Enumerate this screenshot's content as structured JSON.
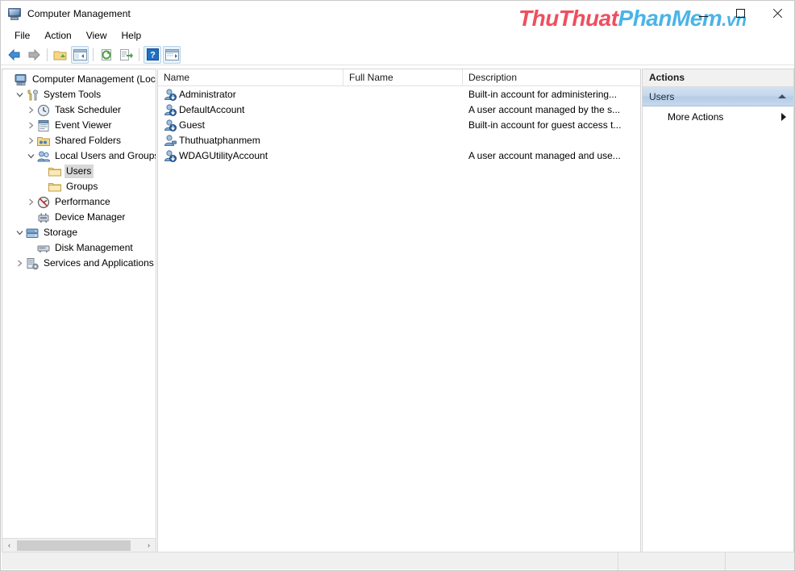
{
  "window": {
    "title": "Computer Management",
    "icon": "computer-icon",
    "controls": {
      "minimize": "–",
      "maximize": "□",
      "close": "✕"
    }
  },
  "watermark": {
    "part1": "ThuThuat",
    "part2": "PhanMem",
    "part3": ".vn"
  },
  "menubar": {
    "items": [
      {
        "label": "File"
      },
      {
        "label": "Action"
      },
      {
        "label": "View"
      },
      {
        "label": "Help"
      }
    ]
  },
  "toolbar": {
    "buttons": [
      {
        "name": "back-icon"
      },
      {
        "name": "forward-icon"
      },
      {
        "name": "separator"
      },
      {
        "name": "up-folder-icon"
      },
      {
        "name": "show-hide-console-tree-icon"
      },
      {
        "name": "separator"
      },
      {
        "name": "refresh-icon"
      },
      {
        "name": "export-list-icon"
      },
      {
        "name": "separator"
      },
      {
        "name": "help-icon"
      },
      {
        "name": "show-action-pane-icon"
      }
    ]
  },
  "tree": {
    "nodes": [
      {
        "label": "Computer Management (Local",
        "icon": "computer-icon",
        "indent": 0,
        "twist": "",
        "selected": false
      },
      {
        "label": "System Tools",
        "icon": "tools-icon",
        "indent": 1,
        "twist": "expanded",
        "selected": false
      },
      {
        "label": "Task Scheduler",
        "icon": "clock-icon",
        "indent": 2,
        "twist": "collapsed",
        "selected": false
      },
      {
        "label": "Event Viewer",
        "icon": "event-viewer-icon",
        "indent": 2,
        "twist": "collapsed",
        "selected": false
      },
      {
        "label": "Shared Folders",
        "icon": "shared-folder-icon",
        "indent": 2,
        "twist": "collapsed",
        "selected": false
      },
      {
        "label": "Local Users and Groups",
        "icon": "users-groups-icon",
        "indent": 2,
        "twist": "expanded",
        "selected": false
      },
      {
        "label": "Users",
        "icon": "folder-icon",
        "indent": 3,
        "twist": "",
        "selected": true
      },
      {
        "label": "Groups",
        "icon": "folder-icon",
        "indent": 3,
        "twist": "",
        "selected": false
      },
      {
        "label": "Performance",
        "icon": "performance-icon",
        "indent": 2,
        "twist": "collapsed",
        "selected": false
      },
      {
        "label": "Device Manager",
        "icon": "device-manager-icon",
        "indent": 2,
        "twist": "",
        "selected": false
      },
      {
        "label": "Storage",
        "icon": "storage-icon",
        "indent": 1,
        "twist": "expanded",
        "selected": false
      },
      {
        "label": "Disk Management",
        "icon": "disk-icon",
        "indent": 2,
        "twist": "",
        "selected": false
      },
      {
        "label": "Services and Applications",
        "icon": "services-icon",
        "indent": 1,
        "twist": "collapsed",
        "selected": false
      }
    ],
    "scrollbar": {
      "left_arrow": "‹",
      "right_arrow": "›"
    }
  },
  "list": {
    "columns": [
      {
        "label": "Name"
      },
      {
        "label": "Full Name"
      },
      {
        "label": "Description"
      }
    ],
    "rows": [
      {
        "name": "Administrator",
        "full_name": "",
        "description": "Built-in account for administering...",
        "icon": "user-disabled-icon"
      },
      {
        "name": "DefaultAccount",
        "full_name": "",
        "description": "A user account managed by the s...",
        "icon": "user-disabled-icon"
      },
      {
        "name": "Guest",
        "full_name": "",
        "description": "Built-in account for guest access t...",
        "icon": "user-disabled-icon"
      },
      {
        "name": "Thuthuatphanmem",
        "full_name": "",
        "description": "",
        "icon": "user-icon"
      },
      {
        "name": "WDAGUtilityAccount",
        "full_name": "",
        "description": "A user account managed and use...",
        "icon": "user-disabled-icon"
      }
    ]
  },
  "actions": {
    "title": "Actions",
    "group_label": "Users",
    "group_collapse_icon": "chevron-up-icon",
    "items": [
      {
        "label": "More Actions",
        "submenu_icon": "chevron-right-icon"
      }
    ]
  },
  "statusbar": {
    "pane1": "",
    "pane2": "",
    "pane3": ""
  },
  "colors": {
    "accent_blue": "#b5cce6",
    "watermark_red": "#ef4f5e",
    "watermark_blue": "#4ab4e8",
    "selection_gray": "#d8d8d8"
  }
}
